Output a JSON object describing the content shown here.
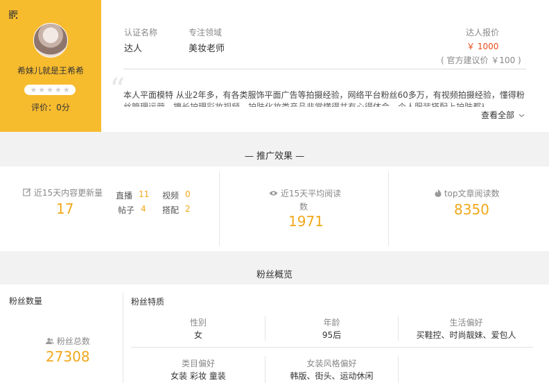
{
  "profile": {
    "name": "希妹儿就是王希希",
    "rating_text": "评价：0分",
    "stars": [
      "★",
      "★",
      "★",
      "★",
      "★"
    ]
  },
  "info": {
    "cert_label": "认证名称",
    "cert_value": "达人",
    "field_label": "专注领域",
    "field_value": "美妆老师",
    "price_label": "达人报价",
    "price_value": "￥ 1000",
    "price_suggest": "( 官方建议价 ￥100 )",
    "bio": "本人平面模特 从业2年多，有各类服饰平面广告等拍摄经验，网络平台粉丝60多万，有视频拍摄经验，懂得粉",
    "bio_line2": "丝管理运营，擅长护理彩妆视频，护肤化妆类产品非常懂得并有心得体会，个人服装搭配上护肤都有丰富的",
    "view_all": "查看全部"
  },
  "promo": {
    "title": "— 推广效果 —",
    "updates_label": "近15天内容更新量",
    "updates_value": "17",
    "live_label": "直播",
    "live_value": "11",
    "video_label": "视频",
    "video_value": "0",
    "post_label": "帖子",
    "post_value": "4",
    "match_label": "搭配",
    "match_value": "2",
    "avg_read_label_1": "近15天平均阅读",
    "avg_read_label_2": "数",
    "avg_read_value": "1971",
    "top_read_label": "top文章阅读数",
    "top_read_value": "8350"
  },
  "fans": {
    "title": "粉丝概览",
    "count_heading": "粉丝数量",
    "total_label": "粉丝总数",
    "total_value": "27308",
    "traits_heading": "粉丝特质",
    "gender_label": "性别",
    "gender_value": "女",
    "age_label": "年龄",
    "age_value": "95后",
    "life_label": "生活偏好",
    "life_value": "买鞋控、时尚靓妹、爱包人",
    "category_label": "类目偏好",
    "category_value": "女装 彩妆 童装",
    "style_label": "女装风格偏好",
    "style_value": "韩版、街头、运动休闲"
  },
  "colors": {
    "accent": "#f7bb2e",
    "number": "#f0a81a",
    "price": "#e64a19"
  }
}
